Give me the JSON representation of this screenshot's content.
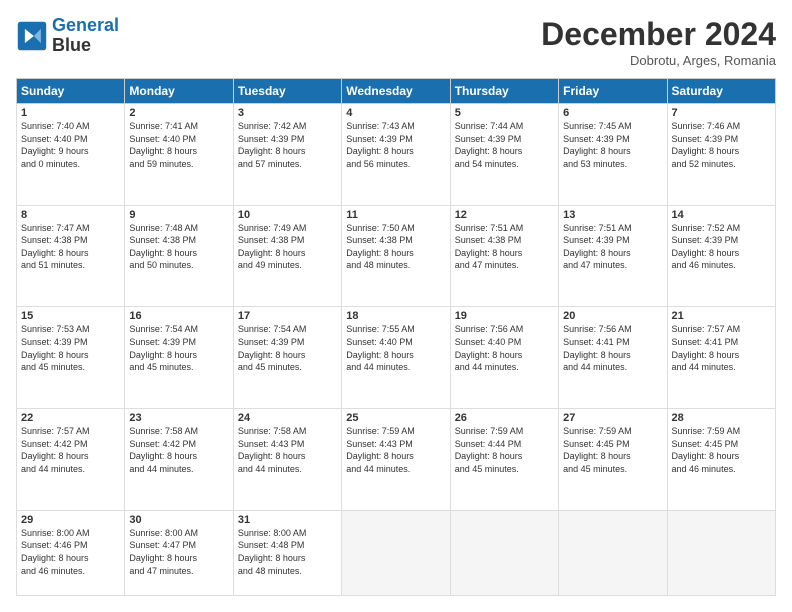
{
  "header": {
    "logo_line1": "General",
    "logo_line2": "Blue",
    "month_title": "December 2024",
    "location": "Dobrotu, Arges, Romania"
  },
  "days_of_week": [
    "Sunday",
    "Monday",
    "Tuesday",
    "Wednesday",
    "Thursday",
    "Friday",
    "Saturday"
  ],
  "weeks": [
    [
      {
        "day": "1",
        "info": "Sunrise: 7:40 AM\nSunset: 4:40 PM\nDaylight: 9 hours\nand 0 minutes."
      },
      {
        "day": "2",
        "info": "Sunrise: 7:41 AM\nSunset: 4:40 PM\nDaylight: 8 hours\nand 59 minutes."
      },
      {
        "day": "3",
        "info": "Sunrise: 7:42 AM\nSunset: 4:39 PM\nDaylight: 8 hours\nand 57 minutes."
      },
      {
        "day": "4",
        "info": "Sunrise: 7:43 AM\nSunset: 4:39 PM\nDaylight: 8 hours\nand 56 minutes."
      },
      {
        "day": "5",
        "info": "Sunrise: 7:44 AM\nSunset: 4:39 PM\nDaylight: 8 hours\nand 54 minutes."
      },
      {
        "day": "6",
        "info": "Sunrise: 7:45 AM\nSunset: 4:39 PM\nDaylight: 8 hours\nand 53 minutes."
      },
      {
        "day": "7",
        "info": "Sunrise: 7:46 AM\nSunset: 4:39 PM\nDaylight: 8 hours\nand 52 minutes."
      }
    ],
    [
      {
        "day": "8",
        "info": "Sunrise: 7:47 AM\nSunset: 4:38 PM\nDaylight: 8 hours\nand 51 minutes."
      },
      {
        "day": "9",
        "info": "Sunrise: 7:48 AM\nSunset: 4:38 PM\nDaylight: 8 hours\nand 50 minutes."
      },
      {
        "day": "10",
        "info": "Sunrise: 7:49 AM\nSunset: 4:38 PM\nDaylight: 8 hours\nand 49 minutes."
      },
      {
        "day": "11",
        "info": "Sunrise: 7:50 AM\nSunset: 4:38 PM\nDaylight: 8 hours\nand 48 minutes."
      },
      {
        "day": "12",
        "info": "Sunrise: 7:51 AM\nSunset: 4:38 PM\nDaylight: 8 hours\nand 47 minutes."
      },
      {
        "day": "13",
        "info": "Sunrise: 7:51 AM\nSunset: 4:39 PM\nDaylight: 8 hours\nand 47 minutes."
      },
      {
        "day": "14",
        "info": "Sunrise: 7:52 AM\nSunset: 4:39 PM\nDaylight: 8 hours\nand 46 minutes."
      }
    ],
    [
      {
        "day": "15",
        "info": "Sunrise: 7:53 AM\nSunset: 4:39 PM\nDaylight: 8 hours\nand 45 minutes."
      },
      {
        "day": "16",
        "info": "Sunrise: 7:54 AM\nSunset: 4:39 PM\nDaylight: 8 hours\nand 45 minutes."
      },
      {
        "day": "17",
        "info": "Sunrise: 7:54 AM\nSunset: 4:39 PM\nDaylight: 8 hours\nand 45 minutes."
      },
      {
        "day": "18",
        "info": "Sunrise: 7:55 AM\nSunset: 4:40 PM\nDaylight: 8 hours\nand 44 minutes."
      },
      {
        "day": "19",
        "info": "Sunrise: 7:56 AM\nSunset: 4:40 PM\nDaylight: 8 hours\nand 44 minutes."
      },
      {
        "day": "20",
        "info": "Sunrise: 7:56 AM\nSunset: 4:41 PM\nDaylight: 8 hours\nand 44 minutes."
      },
      {
        "day": "21",
        "info": "Sunrise: 7:57 AM\nSunset: 4:41 PM\nDaylight: 8 hours\nand 44 minutes."
      }
    ],
    [
      {
        "day": "22",
        "info": "Sunrise: 7:57 AM\nSunset: 4:42 PM\nDaylight: 8 hours\nand 44 minutes."
      },
      {
        "day": "23",
        "info": "Sunrise: 7:58 AM\nSunset: 4:42 PM\nDaylight: 8 hours\nand 44 minutes."
      },
      {
        "day": "24",
        "info": "Sunrise: 7:58 AM\nSunset: 4:43 PM\nDaylight: 8 hours\nand 44 minutes."
      },
      {
        "day": "25",
        "info": "Sunrise: 7:59 AM\nSunset: 4:43 PM\nDaylight: 8 hours\nand 44 minutes."
      },
      {
        "day": "26",
        "info": "Sunrise: 7:59 AM\nSunset: 4:44 PM\nDaylight: 8 hours\nand 45 minutes."
      },
      {
        "day": "27",
        "info": "Sunrise: 7:59 AM\nSunset: 4:45 PM\nDaylight: 8 hours\nand 45 minutes."
      },
      {
        "day": "28",
        "info": "Sunrise: 7:59 AM\nSunset: 4:45 PM\nDaylight: 8 hours\nand 46 minutes."
      }
    ],
    [
      {
        "day": "29",
        "info": "Sunrise: 8:00 AM\nSunset: 4:46 PM\nDaylight: 8 hours\nand 46 minutes."
      },
      {
        "day": "30",
        "info": "Sunrise: 8:00 AM\nSunset: 4:47 PM\nDaylight: 8 hours\nand 47 minutes."
      },
      {
        "day": "31",
        "info": "Sunrise: 8:00 AM\nSunset: 4:48 PM\nDaylight: 8 hours\nand 48 minutes."
      },
      {
        "day": "",
        "info": ""
      },
      {
        "day": "",
        "info": ""
      },
      {
        "day": "",
        "info": ""
      },
      {
        "day": "",
        "info": ""
      }
    ]
  ]
}
